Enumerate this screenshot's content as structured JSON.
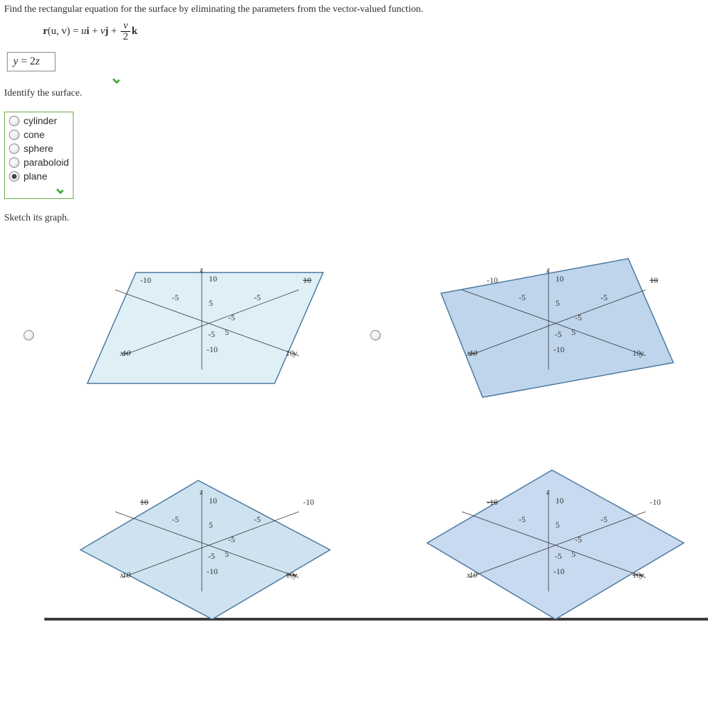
{
  "problem": {
    "prompt_main": "Find the rectangular equation for the surface by eliminating the parameters from the vector-valued function.",
    "eqn_lhs": "r",
    "eqn_args": "(u, v)",
    "eqn_eq": " = ",
    "eqn_term1_var": "u",
    "eqn_term1_vec": "i",
    "eqn_plus1": " + ",
    "eqn_term2_var": "v",
    "eqn_term2_vec": "j",
    "eqn_plus2": " + ",
    "eqn_frac_num": "v",
    "eqn_frac_den": "2",
    "eqn_term3_vec": "k"
  },
  "answer1": {
    "lhs_var": "y",
    "eq": " = ",
    "rhs_coef": "2",
    "rhs_var": "z"
  },
  "identify": {
    "prompt": "Identify the surface.",
    "options": [
      {
        "label": "cylinder",
        "selected": false
      },
      {
        "label": "cone",
        "selected": false
      },
      {
        "label": "sphere",
        "selected": false
      },
      {
        "label": "paraboloid",
        "selected": false
      },
      {
        "label": "plane",
        "selected": true
      }
    ]
  },
  "sketch": {
    "prompt": "Sketch its graph.",
    "axis_labels": {
      "x": "x",
      "y": "y",
      "z": "z"
    },
    "axis_ticks": [
      "-10",
      "-5",
      "5",
      "10"
    ],
    "z_ticks": [
      "10",
      "5",
      "-5",
      "-10"
    ],
    "options": [
      {
        "fill": "#dfeff6",
        "tilt": "back-right",
        "selected": false
      },
      {
        "fill": "#bfd5eb",
        "tilt": "back-left",
        "selected": false
      },
      {
        "fill": "#cee3ef",
        "tilt": "flat",
        "selected": false
      },
      {
        "fill": "#c8daf0",
        "tilt": "fore-right",
        "selected": false
      }
    ]
  }
}
